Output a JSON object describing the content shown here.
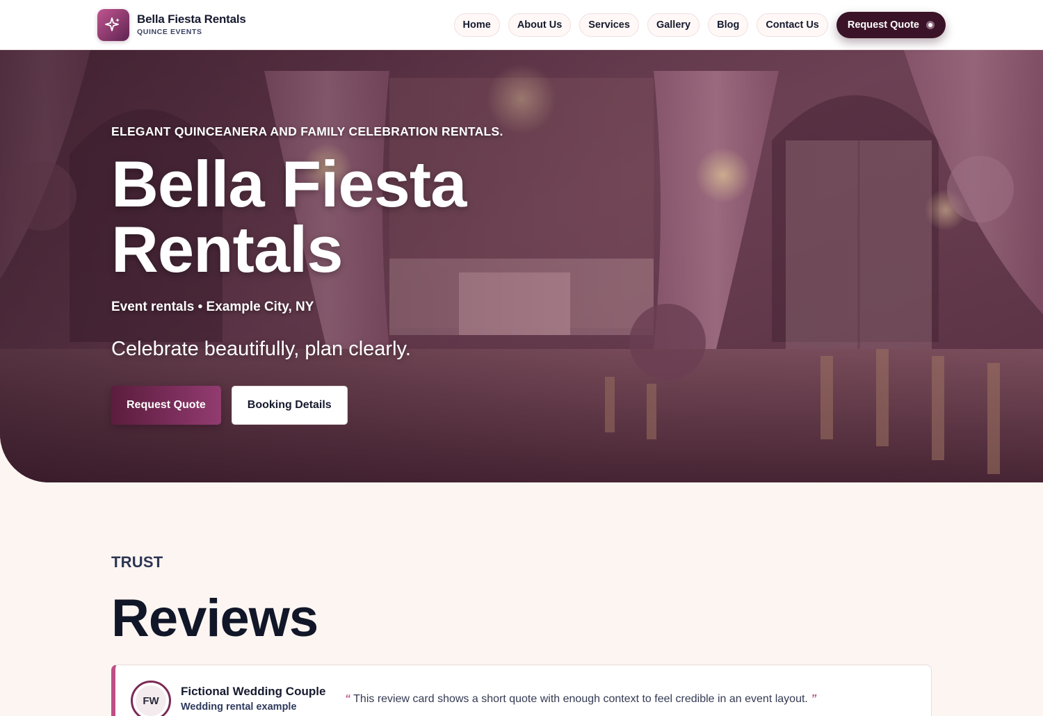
{
  "brand": {
    "name": "Bella Fiesta Rentals",
    "subtitle": "QUINCE EVENTS",
    "logo_icon": "sparkle-icon"
  },
  "nav": {
    "items": [
      {
        "label": "Home"
      },
      {
        "label": "About Us"
      },
      {
        "label": "Services"
      },
      {
        "label": "Gallery"
      },
      {
        "label": "Blog"
      },
      {
        "label": "Contact Us"
      }
    ],
    "cta_label": "Request Quote"
  },
  "hero": {
    "eyebrow": "ELEGANT QUINCEANERA AND FAMILY CELEBRATION RENTALS.",
    "title": "Bella Fiesta Rentals",
    "location": "Event rentals • Example City, NY",
    "tagline": "Celebrate beautifully, plan clearly.",
    "primary_button": "Request Quote",
    "secondary_button": "Booking Details"
  },
  "reviews": {
    "eyebrow": "TRUST",
    "title": "Reviews",
    "items": [
      {
        "initials": "FW",
        "name": "Fictional Wedding Couple",
        "role": "Wedding rental example",
        "open_quote": "“",
        "quote": "This review card shows a short quote with enough context to feel credible in an event layout.",
        "close_quote": "”"
      }
    ]
  },
  "colors": {
    "accent": "#c04e86",
    "brand_dark": "#3a1328",
    "text_dark": "#161a2e",
    "page_bg": "#fdf5f1"
  }
}
